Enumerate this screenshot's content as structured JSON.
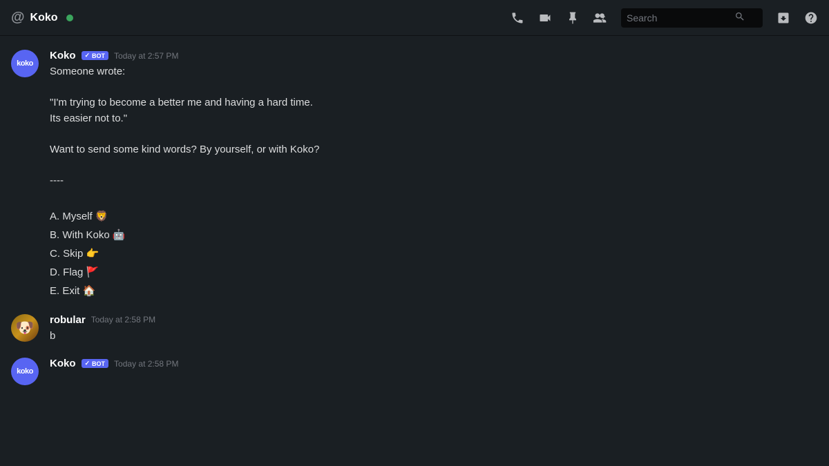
{
  "header": {
    "channel_symbol": "@",
    "channel_name": "Koko",
    "search_placeholder": "Search"
  },
  "messages": [
    {
      "id": "msg1",
      "author": "Koko",
      "author_type": "bot",
      "avatar_type": "koko",
      "timestamp": "Today at 2:57 PM",
      "lines": [
        "Someone wrote:",
        "",
        "\"I'm trying to become a better me and having a hard time.",
        "Its easier not to.\"",
        "",
        "Want to send some kind words? By yourself, or with Koko?",
        "",
        "----",
        "",
        "A. Myself 🦁",
        "B. With Koko 🤖",
        "C. Skip 👉",
        "D. Flag 🚩",
        "E. Exit 🏠"
      ]
    },
    {
      "id": "msg2",
      "author": "robular",
      "author_type": "user",
      "avatar_type": "robular",
      "timestamp": "Today at 2:58 PM",
      "lines": [
        "b"
      ]
    },
    {
      "id": "msg3",
      "author": "Koko",
      "author_type": "bot",
      "avatar_type": "koko",
      "timestamp": "Today at 2:58 PM",
      "lines": []
    }
  ],
  "icons": {
    "phone_icon": "📞",
    "video_icon": "📹",
    "pin_icon": "📌",
    "add_member_icon": "👤",
    "search_icon": "🔍",
    "inbox_icon": "📥",
    "help_icon": "❓"
  }
}
